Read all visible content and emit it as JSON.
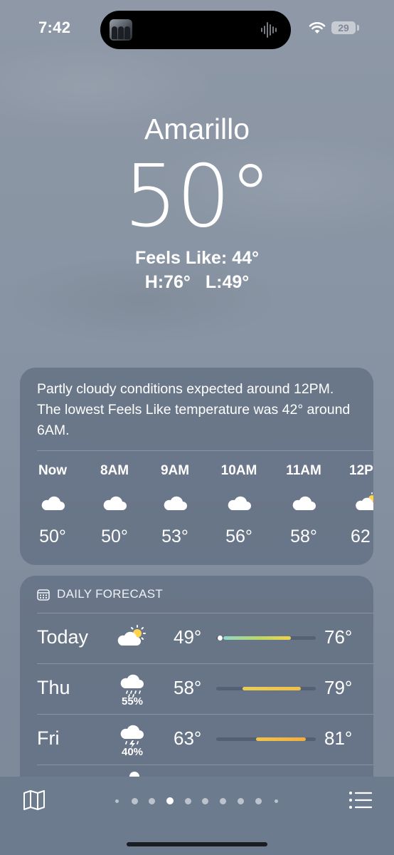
{
  "status_bar": {
    "time": "7:42",
    "battery": "29"
  },
  "location": {
    "city": "Amarillo",
    "temperature": "50°",
    "feels_like": "Feels Like: 44°",
    "high": "H:76°",
    "low": "L:49°"
  },
  "hourly": {
    "summary": "Partly cloudy conditions expected around 12PM. The lowest Feels Like temperature was 42° around 6AM.",
    "hours": [
      {
        "label": "Now",
        "icon": "cloud-icon",
        "temp": "50°"
      },
      {
        "label": "8AM",
        "icon": "cloud-icon",
        "temp": "50°"
      },
      {
        "label": "9AM",
        "icon": "cloud-icon",
        "temp": "53°"
      },
      {
        "label": "10AM",
        "icon": "cloud-icon",
        "temp": "56°"
      },
      {
        "label": "11AM",
        "icon": "cloud-icon",
        "temp": "58°"
      },
      {
        "label": "12P",
        "icon": "partly-cloudy-icon",
        "temp": "62"
      }
    ]
  },
  "daily": {
    "heading": "DAILY FORECAST",
    "days": [
      {
        "day": "Today",
        "icon": "partly-cloudy-icon",
        "precip": "",
        "low": "49°",
        "high": "76°"
      },
      {
        "day": "Thu",
        "icon": "rain-icon",
        "precip": "55%",
        "low": "58°",
        "high": "79°"
      },
      {
        "day": "Fri",
        "icon": "thunderstorm-icon",
        "precip": "40%",
        "low": "63°",
        "high": "81°"
      }
    ],
    "colors": {
      "today_bar": "#7fd3b8",
      "thu_bar": "#f0c950",
      "fri_bar": "#f3b540"
    }
  },
  "toolbar": {
    "page_count": 10,
    "active_page": 4
  }
}
